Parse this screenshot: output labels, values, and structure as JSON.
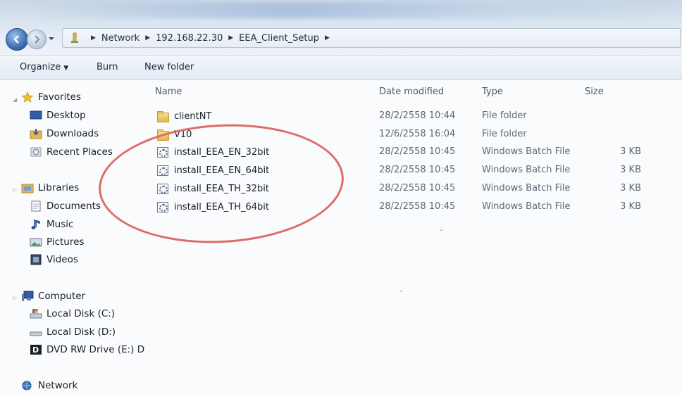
{
  "address_bar": {
    "breadcrumbs": [
      "Network",
      "192.168.22.30",
      "EEA_Client_Setup"
    ]
  },
  "toolbar": {
    "organize_label": "Organize",
    "burn_label": "Burn",
    "new_folder_label": "New folder"
  },
  "navigation": {
    "favorites": {
      "label": "Favorites",
      "items": [
        {
          "label": "Desktop",
          "icon": "desktop-icon"
        },
        {
          "label": "Downloads",
          "icon": "downloads-icon"
        },
        {
          "label": "Recent Places",
          "icon": "recent-places-icon"
        }
      ]
    },
    "libraries": {
      "label": "Libraries",
      "items": [
        {
          "label": "Documents",
          "icon": "documents-icon"
        },
        {
          "label": "Music",
          "icon": "music-icon"
        },
        {
          "label": "Pictures",
          "icon": "pictures-icon"
        },
        {
          "label": "Videos",
          "icon": "videos-icon"
        }
      ]
    },
    "computer": {
      "label": "Computer",
      "items": [
        {
          "label": "Local Disk (C:)",
          "icon": "system-drive-icon"
        },
        {
          "label": "Local Disk (D:)",
          "icon": "drive-icon"
        },
        {
          "label": "DVD RW Drive (E:) D",
          "icon": "dvd-drive-icon"
        }
      ]
    },
    "network": {
      "label": "Network"
    }
  },
  "file_list": {
    "columns": {
      "name": "Name",
      "date": "Date modified",
      "type": "Type",
      "size": "Size"
    },
    "rows": [
      {
        "name": "clientNT",
        "date": "28/2/2558 10:44",
        "type": "File folder",
        "size": "",
        "icon": "folder-icon"
      },
      {
        "name": "V10",
        "date": "12/6/2558 16:04",
        "type": "File folder",
        "size": "",
        "icon": "folder-icon"
      },
      {
        "name": "install_EEA_EN_32bit",
        "date": "28/2/2558 10:45",
        "type": "Windows Batch File",
        "size": "3 KB",
        "icon": "batch-file-icon"
      },
      {
        "name": "install_EEA_EN_64bit",
        "date": "28/2/2558 10:45",
        "type": "Windows Batch File",
        "size": "3 KB",
        "icon": "batch-file-icon"
      },
      {
        "name": "install_EEA_TH_32bit",
        "date": "28/2/2558 10:45",
        "type": "Windows Batch File",
        "size": "3 KB",
        "icon": "batch-file-icon"
      },
      {
        "name": "install_EEA_TH_64bit",
        "date": "28/2/2558 10:45",
        "type": "Windows Batch File",
        "size": "3 KB",
        "icon": "batch-file-icon"
      }
    ]
  },
  "colors": {
    "annotation_circle": "#e06a6a",
    "toolbar_bg": "#e3eaf3"
  }
}
